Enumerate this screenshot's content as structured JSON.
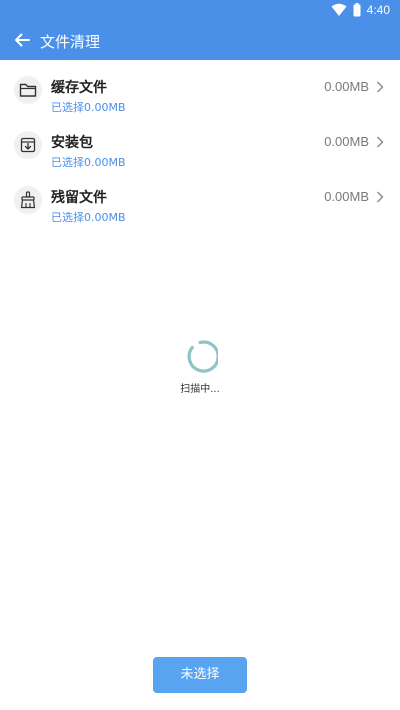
{
  "status_bar": {
    "time": "4:40",
    "icons": [
      "wifi-icon",
      "battery-icon"
    ]
  },
  "app_bar": {
    "back_icon": "back-arrow-icon",
    "title": "文件清理"
  },
  "items": [
    {
      "icon": "folder-icon",
      "title": "缓存文件",
      "selected": "已选择0.00MB",
      "size": "0.00MB"
    },
    {
      "icon": "package-download-icon",
      "title": "安装包",
      "selected": "已选择0.00MB",
      "size": "0.00MB"
    },
    {
      "icon": "broom-icon",
      "title": "残留文件",
      "selected": "已选择0.00MB",
      "size": "0.00MB"
    }
  ],
  "scan": {
    "label": "扫描中..."
  },
  "bottom": {
    "button_label": "未选择"
  },
  "colors": {
    "primary": "#4a90e8",
    "button": "#58a4f0",
    "spinner": "#8cc4c8"
  }
}
